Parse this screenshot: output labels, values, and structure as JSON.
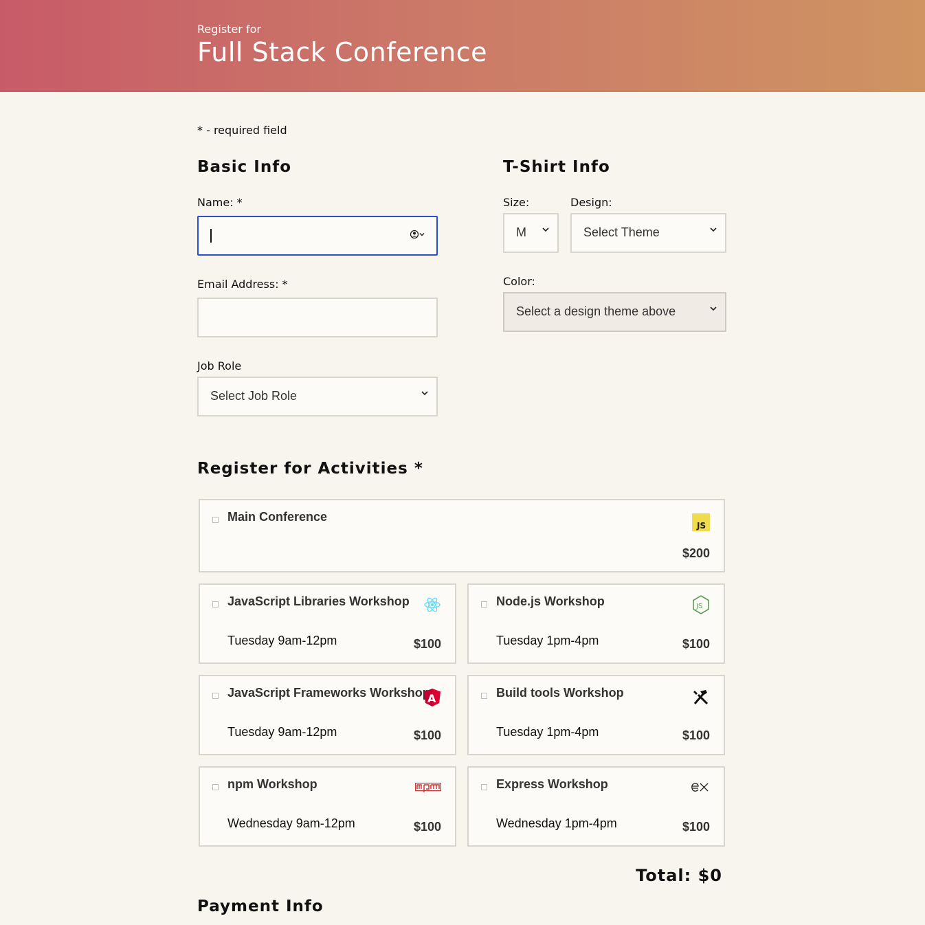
{
  "header": {
    "subtitle": "Register for",
    "title": "Full Stack Conference"
  },
  "required_note": "* - required field",
  "basic_info": {
    "heading": "Basic Info",
    "name_label": "Name: *",
    "name_value": "",
    "email_label": "Email Address: *",
    "email_value": "",
    "job_role_label": "Job Role",
    "job_role_selected": "Select Job Role"
  },
  "tshirt_info": {
    "heading": "T-Shirt Info",
    "size_label": "Size:",
    "size_selected": "M",
    "design_label": "Design:",
    "design_selected": "Select Theme",
    "color_label": "Color:",
    "color_selected": "Select a design theme above"
  },
  "activities": {
    "heading": "Register for Activities *",
    "items": [
      {
        "name": "Main Conference",
        "time": "",
        "cost": "$200",
        "icon": "javascript-icon"
      },
      {
        "name": "JavaScript Libraries Workshop",
        "time": "Tuesday 9am-12pm",
        "cost": "$100",
        "icon": "react-icon"
      },
      {
        "name": "Node.js Workshop",
        "time": "Tuesday 1pm-4pm",
        "cost": "$100",
        "icon": "nodejs-icon"
      },
      {
        "name": "JavaScript Frameworks Workshop",
        "time": "Tuesday 9am-12pm",
        "cost": "$100",
        "icon": "angular-icon"
      },
      {
        "name": "Build tools Workshop",
        "time": "Tuesday 1pm-4pm",
        "cost": "$100",
        "icon": "tools-icon"
      },
      {
        "name": "npm Workshop",
        "time": "Wednesday 9am-12pm",
        "cost": "$100",
        "icon": "npm-icon"
      },
      {
        "name": "Express Workshop",
        "time": "Wednesday 1pm-4pm",
        "cost": "$100",
        "icon": "express-icon"
      }
    ],
    "total": "Total: $0"
  },
  "payment": {
    "heading": "Payment Info"
  },
  "colors": {
    "header_start": "#c85b68",
    "header_end": "#cf9462",
    "focus_border": "#2a4fd0",
    "background": "#f8f4ee"
  }
}
